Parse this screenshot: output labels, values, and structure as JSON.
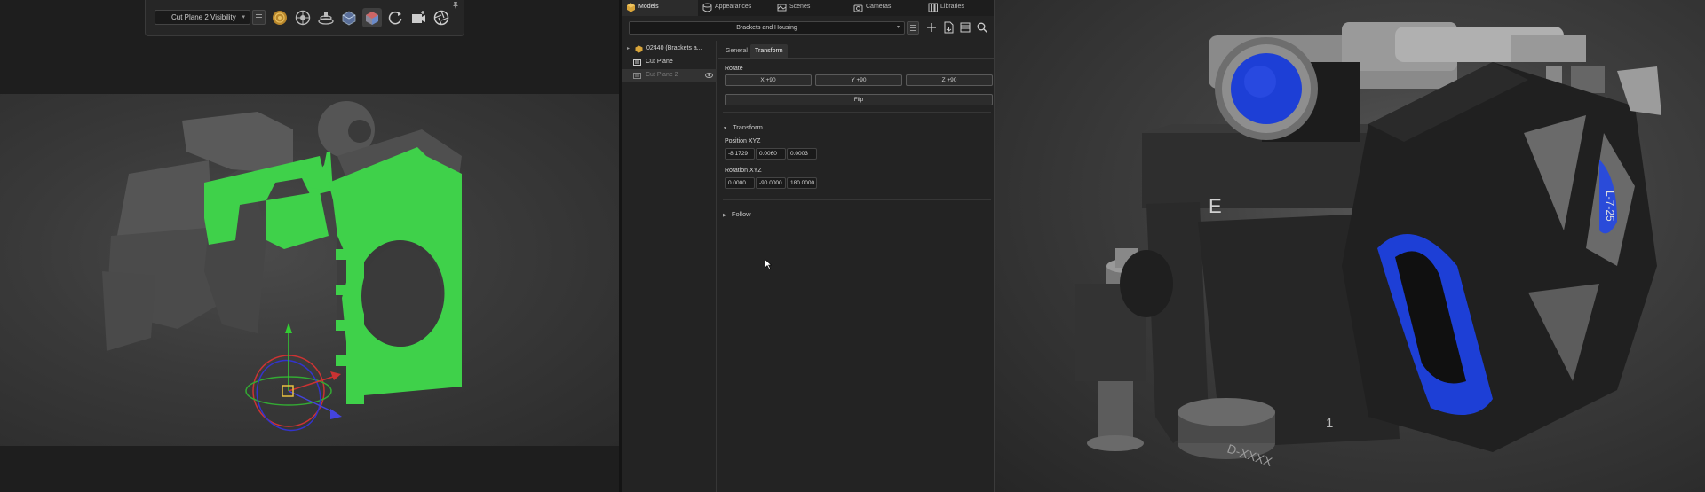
{
  "viewport_toolbar": {
    "cut_plane_select": "Cut Plane 2 Visibility",
    "icons": [
      "material-ball-icon",
      "environment-icon",
      "turntable-icon",
      "cube-icon",
      "cube-active-icon",
      "refresh-icon",
      "camera-add-icon",
      "aperture-icon",
      "pin-icon"
    ]
  },
  "panel_tabs": [
    {
      "label": "Models",
      "icon": "models-icon"
    },
    {
      "label": "Appearances",
      "icon": "appearances-icon"
    },
    {
      "label": "Scenes",
      "icon": "scenes-icon"
    },
    {
      "label": "Cameras",
      "icon": "cameras-icon"
    },
    {
      "label": "Libraries",
      "icon": "libraries-icon"
    }
  ],
  "model_select": "Brackets and Housing",
  "tree": [
    {
      "label": "02440 (Brackets a...",
      "expanded": false
    },
    {
      "label": "Cut Plane"
    },
    {
      "label": "Cut Plane 2",
      "visible": true
    }
  ],
  "property_tabs": [
    "General",
    "Transform"
  ],
  "transform": {
    "rotate_label": "Rotate",
    "rotate_buttons": [
      "X +90",
      "Y +90",
      "Z +90"
    ],
    "flip_label": "Flip",
    "section_label": "Transform",
    "position_label": "Position XYZ",
    "position": [
      "-8.1729",
      "0.0060",
      "0.0003"
    ],
    "rotation_label": "Rotation XYZ",
    "rotation": [
      "0.0000",
      "-90.0000",
      "180.0000"
    ],
    "follow_label": "Follow"
  },
  "right_render": {
    "face_letter": "E",
    "part_number": "D-XXXX",
    "digit": "1",
    "side_text": "L-7-25"
  },
  "colors": {
    "cut_fill": "#3fd14a",
    "accent_blue": "#1d3fd6",
    "panel_bg": "#232323"
  }
}
